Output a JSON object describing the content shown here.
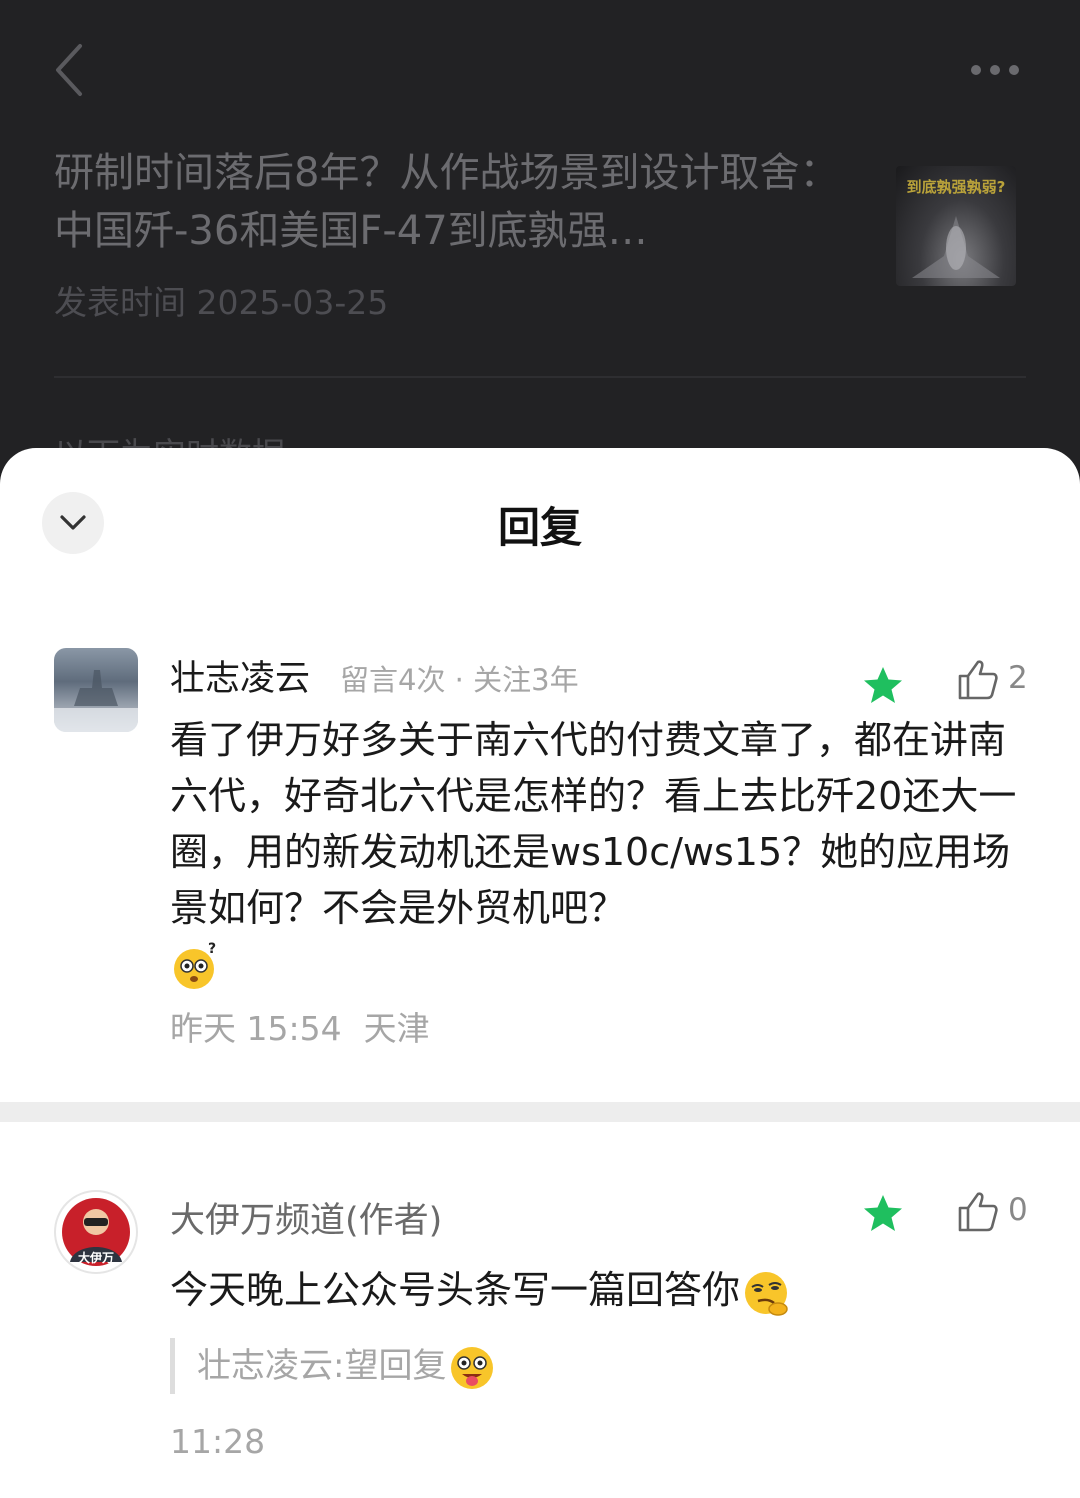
{
  "article": {
    "title": "研制时间落后8年？从作战场景到设计取舍：中国歼-36和美国F-47到底孰强…",
    "date": "发表时间 2025-03-25",
    "thumbnail_text": "到底孰强孰弱?",
    "peek_text": "以下为实时数据"
  },
  "sheet": {
    "title": "回复"
  },
  "comments": [
    {
      "user": "壮志凌云",
      "meta": "留言4次 · 关注3年",
      "likes": "2",
      "text": "看了伊万好多关于南六代的付费文章了，都在讲南六代，好奇北六代是怎样的？看上去比歼20还大一圈，用的新发动机还是ws10c/ws15？她的应用场景如何？不会是外贸机吧？",
      "emoji": "astonished-question-emoji",
      "time": "昨天 15:54",
      "location": "天津"
    },
    {
      "user": "大伊万频道(作者)",
      "avatar_text": "大伊万",
      "likes": "0",
      "text": "今天晚上公众号头条写一篇回答你",
      "emoji": "thinking-smirk-emoji",
      "quote": "壮志凌云:望回复",
      "quote_emoji": "tongue-out-emoji",
      "time": "11:28"
    }
  ],
  "colors": {
    "star_green": "#1fbf5f",
    "dimmed_background": "#222224",
    "sheet_background": "#ffffff"
  }
}
